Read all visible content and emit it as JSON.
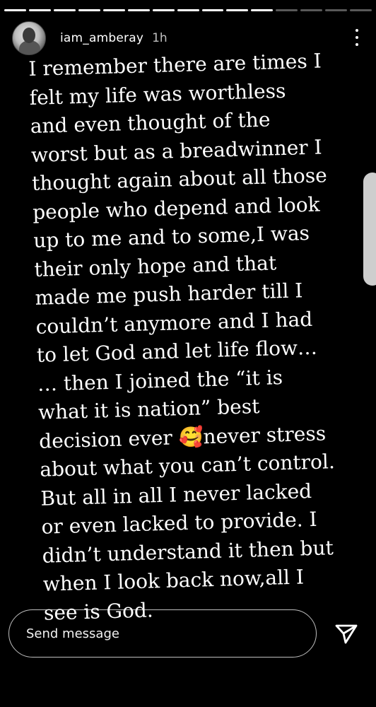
{
  "story": {
    "progress": {
      "total_segments": 15,
      "completed_segments": 11
    },
    "header": {
      "username": "iam_amberay",
      "time": "1h",
      "avatar_icon": "profile-avatar",
      "more_icon": "more-vertical-icon"
    },
    "text_lines": [
      "I remember there are times I",
      "felt my life was worthless",
      "and even thought of the",
      "worst but as a breadwinner I",
      "thought again about all those",
      "people who depend and look",
      "up to me and to some,I was",
      "their only hope and that",
      "made me push harder till I",
      "couldn’t anymore and I had",
      "to let God and let life flow…",
      "… then I joined the “it is",
      "what it is nation” best",
      "never stress",
      "about what you can’t control.",
      "But all in all I never lacked",
      "or even lacked to provide. I",
      "didn’t understand it then but",
      "when I look back now,all I",
      "see is God."
    ],
    "line14_prefix": "decision ever ",
    "emoji": "🥰",
    "emoji_name": "smiling-face-with-hearts-icon"
  },
  "composer": {
    "placeholder": "Send message",
    "send_icon": "send-icon"
  },
  "colors": {
    "background": "#000000",
    "text": "#ffffff",
    "progress_done": "#ffffff",
    "progress_remaining": "#5a5a5a"
  }
}
